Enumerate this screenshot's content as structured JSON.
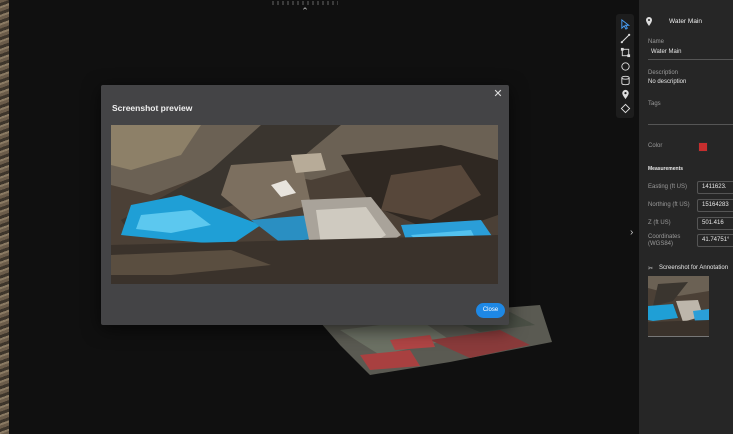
{
  "dialog": {
    "title": "Screenshot preview",
    "close_button_label": "Close",
    "close_icon": "close-icon"
  },
  "toolbar": {
    "tools": [
      "select-icon",
      "measure-line-icon",
      "area-icon",
      "polygon-icon",
      "volume-icon",
      "location-pin-icon",
      "point-icon"
    ]
  },
  "panel": {
    "header_title": "Water Main",
    "name_label": "Name",
    "name_value": "Water Main",
    "description_label": "Description",
    "description_value": "No description",
    "tags_label": "Tags",
    "color_label": "Color",
    "color_value": "#c62e2e",
    "measurements_heading": "Measurements",
    "easting_label": "Easting (ft US)",
    "easting_value": "1411623.",
    "northing_label": "Northing (ft US)",
    "northing_value": "15164283",
    "z_label": "Z (ft US)",
    "z_value": "501.416",
    "coordinates_label_line1": "Coordinates",
    "coordinates_label_line2": "(WGS84)",
    "coordinates_value": "41.74751°",
    "screenshot_heading": "Screenshot for Annotation"
  },
  "colors": {
    "accent": "#1e88e5",
    "panel_bg": "#262626",
    "dialog_bg": "#444446",
    "annotation_color": "#c62e2e"
  }
}
